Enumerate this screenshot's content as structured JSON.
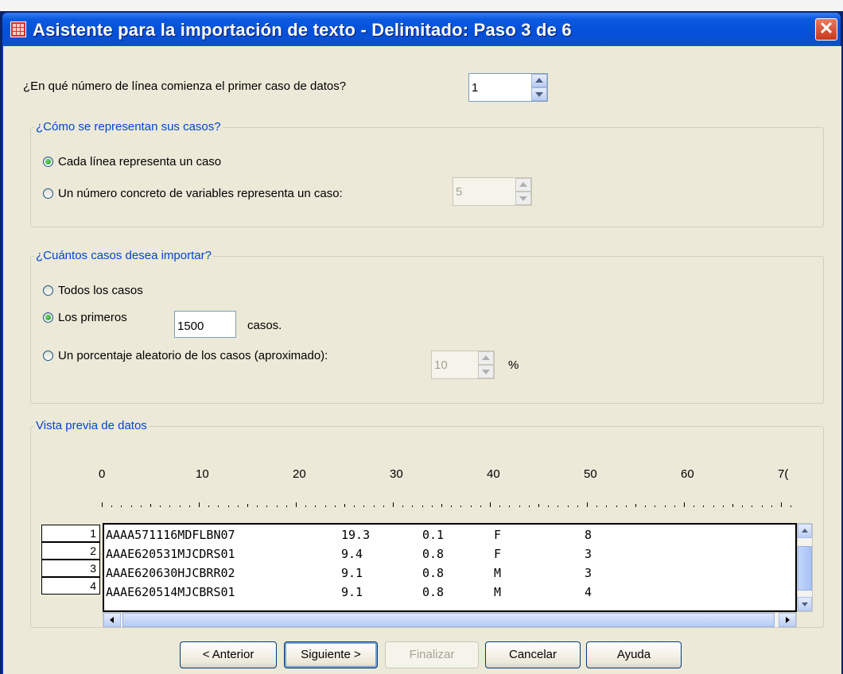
{
  "window": {
    "title": "Asistente para la importación de texto - Delimitado: Paso 3 de 6",
    "close_glyph": "✕"
  },
  "first_line": {
    "label": "¿En qué número de línea comienza el primer caso de datos?",
    "value": "1"
  },
  "cases_group": {
    "legend": "¿Cómo se representan sus casos?",
    "option_each_line": "Cada línea representa un caso",
    "option_fixed_vars": "Un número concreto de variables representa un caso:",
    "fixed_vars_value": "5",
    "selected": "each_line"
  },
  "import_group": {
    "legend": "¿Cuántos casos desea importar?",
    "option_all": "Todos los casos",
    "option_first": "Los primeros",
    "first_value": "1500",
    "first_suffix": "casos.",
    "option_random": "Un porcentaje aleatorio de los casos (aproximado):",
    "random_value": "10",
    "random_suffix": "%",
    "selected": "first"
  },
  "preview": {
    "legend": "Vista previa de datos",
    "ruler_labels": [
      "0",
      "10",
      "20",
      "30",
      "40",
      "50",
      "60",
      "7("
    ],
    "row_numbers": [
      "1",
      "2",
      "3",
      "4"
    ],
    "rows": [
      [
        "AAAA571116MDFLBN07",
        "19.3",
        "0.1",
        "F",
        "8"
      ],
      [
        "AAAE620531MJCDRS01",
        "9.4",
        "0.8",
        "F",
        "3"
      ],
      [
        "AAAE620630HJCBRR02",
        "9.1",
        "0.8",
        "M",
        "3"
      ],
      [
        "AAAE620514MJCBRS01",
        "9.1",
        "0.8",
        "M",
        "4"
      ]
    ]
  },
  "buttons": {
    "back": "< Anterior",
    "next": "Siguiente >",
    "finish": "Finalizar",
    "cancel": "Cancelar",
    "help": "Ayuda"
  },
  "colors": {
    "titlebar": "#0450d8",
    "legend_text": "#0046d5",
    "dialog_bg": "#ece9d8"
  }
}
